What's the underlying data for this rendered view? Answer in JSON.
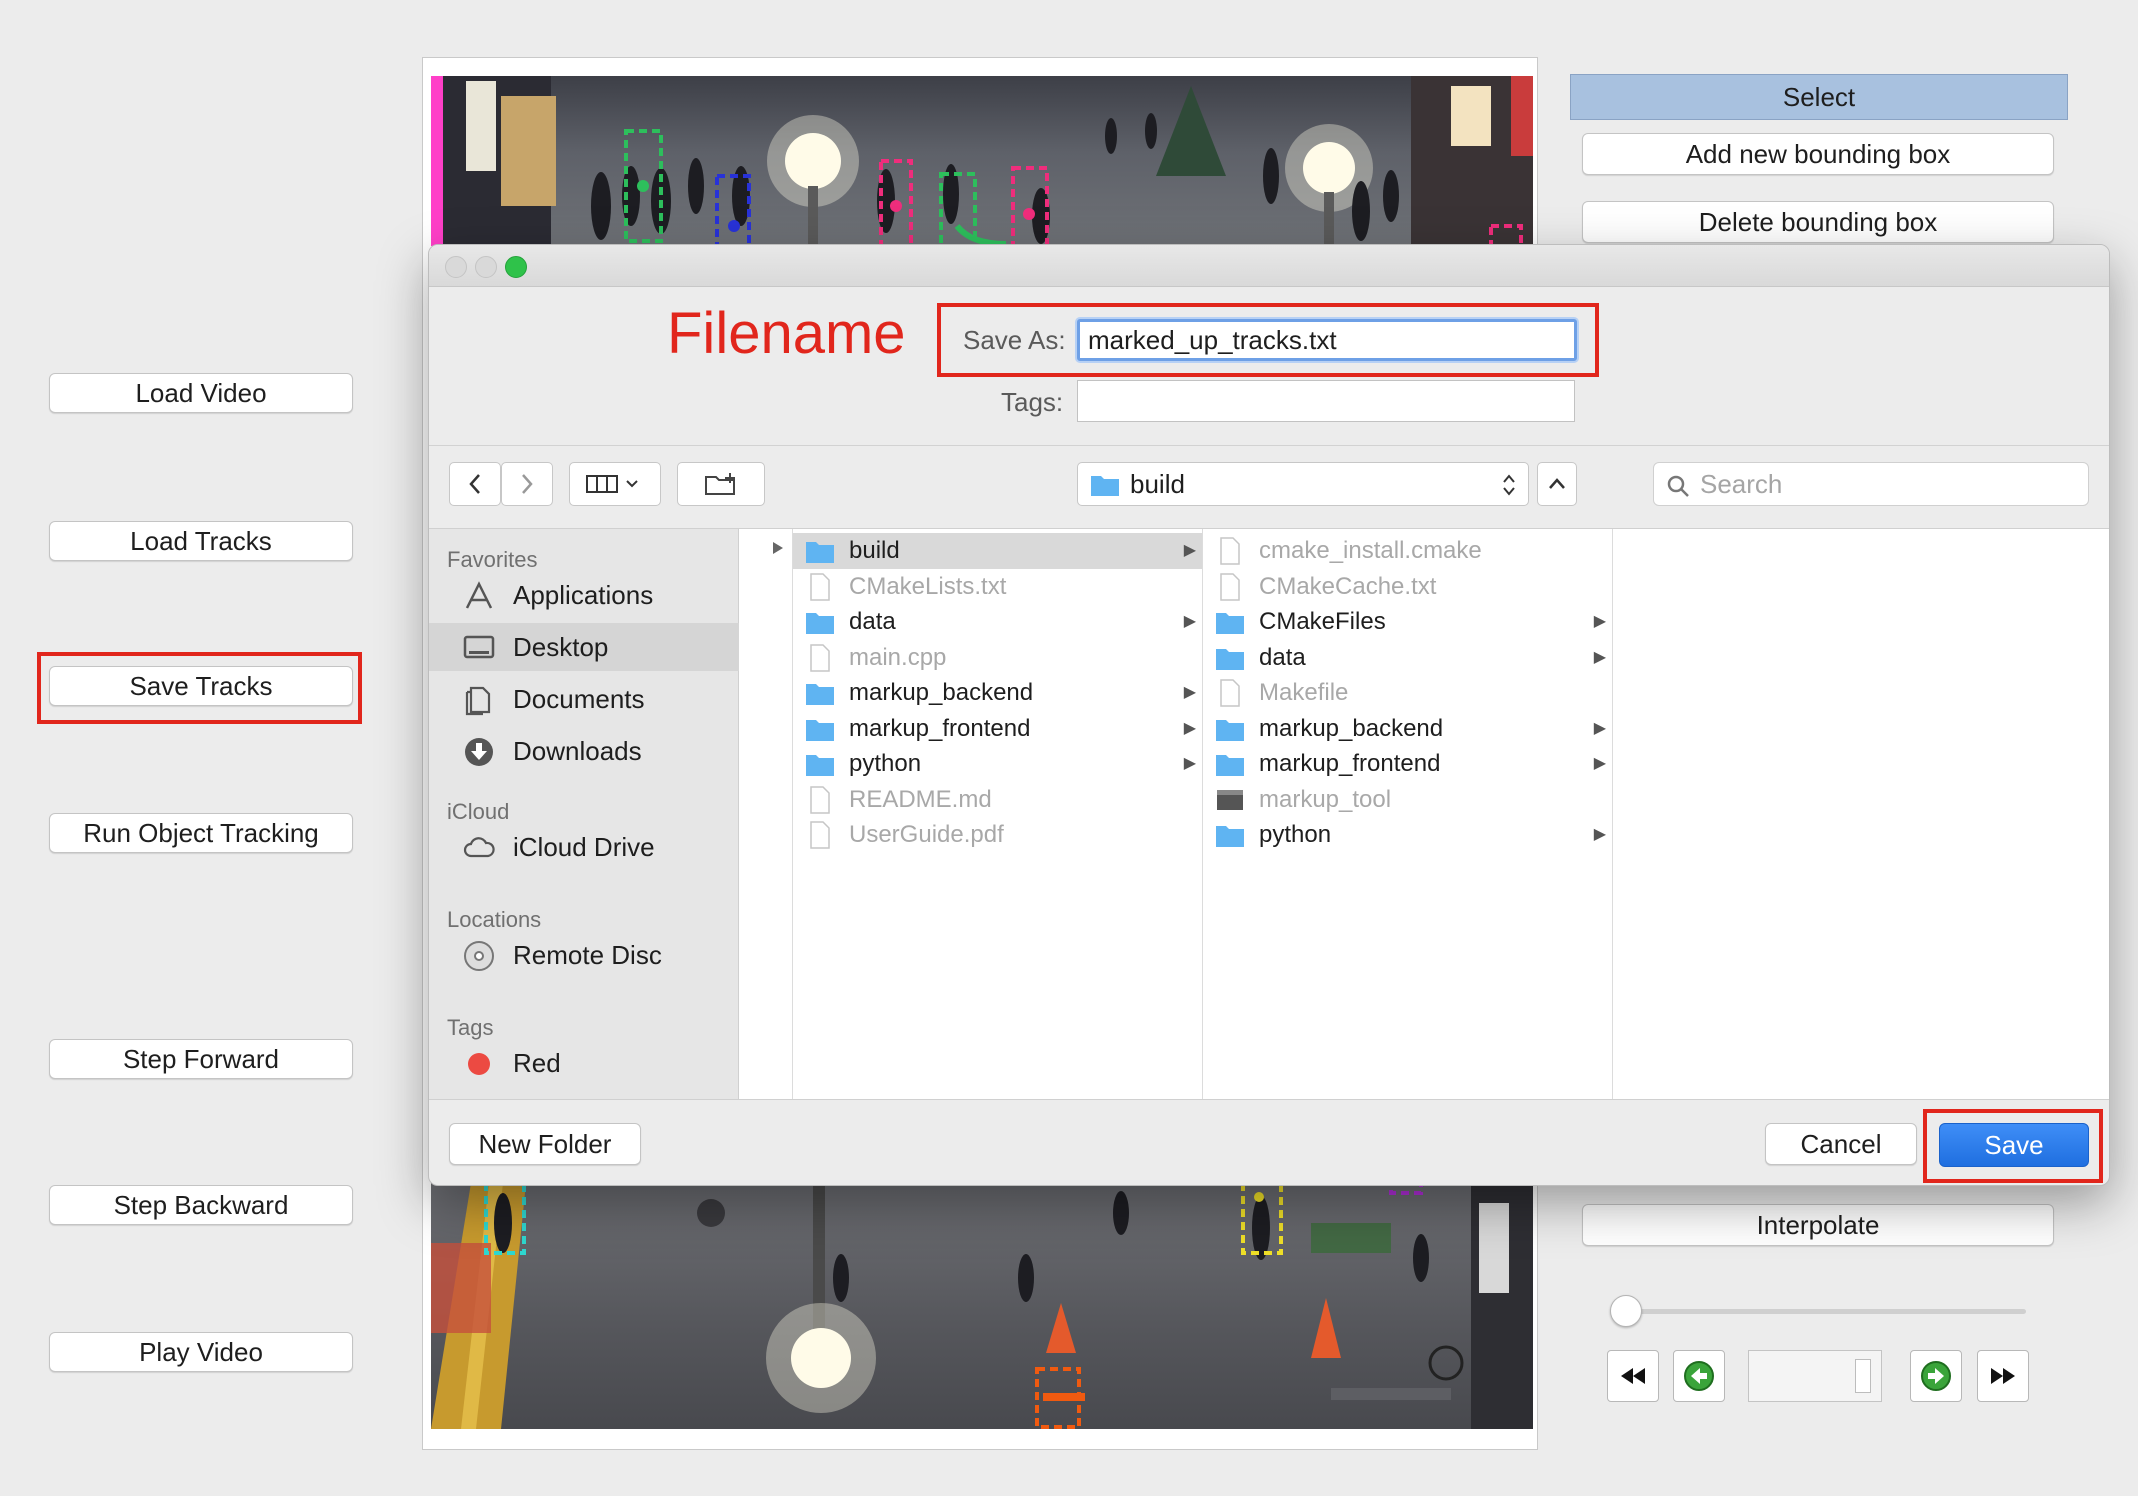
{
  "left_panel": {
    "buttons": [
      {
        "label": "Load Video"
      },
      {
        "label": "Load Tracks"
      },
      {
        "label": "Save Tracks"
      },
      {
        "label": "Run Object Tracking"
      },
      {
        "label": "Step Forward"
      },
      {
        "label": "Step Backward"
      },
      {
        "label": "Play Video"
      }
    ]
  },
  "right_panel": {
    "select_label": "Select",
    "add_box_label": "Add new bounding box",
    "delete_box_label": "Delete bounding box",
    "interpolate_label": "Interpolate",
    "frame_slider_fraction": 0.0
  },
  "dialog": {
    "annotation_label": "Filename",
    "save_as_label": "Save As:",
    "save_as_value": "marked_up_tracks.txt",
    "tags_label": "Tags:",
    "path_label": "build",
    "search_placeholder": "Search",
    "sidebar": {
      "favorites_heading": "Favorites",
      "favorites": [
        "Applications",
        "Desktop",
        "Documents",
        "Downloads"
      ],
      "icloud_heading": "iCloud",
      "icloud": [
        "iCloud Drive"
      ],
      "locations_heading": "Locations",
      "locations": [
        "Remote Disc"
      ],
      "tags_heading": "Tags",
      "tags": [
        "Red"
      ]
    },
    "column_2": [
      {
        "name": "build",
        "type": "folder",
        "selected": true
      },
      {
        "name": "CMakeLists.txt",
        "type": "file",
        "dim": true
      },
      {
        "name": "data",
        "type": "folder"
      },
      {
        "name": "main.cpp",
        "type": "file",
        "dim": true
      },
      {
        "name": "markup_backend",
        "type": "folder"
      },
      {
        "name": "markup_frontend",
        "type": "folder"
      },
      {
        "name": "python",
        "type": "folder"
      },
      {
        "name": "README.md",
        "type": "file",
        "dim": true
      },
      {
        "name": "UserGuide.pdf",
        "type": "file",
        "dim": true
      }
    ],
    "column_3": [
      {
        "name": "cmake_install.cmake",
        "type": "file",
        "dim": true
      },
      {
        "name": "CMakeCache.txt",
        "type": "file",
        "dim": true
      },
      {
        "name": "CMakeFiles",
        "type": "folder"
      },
      {
        "name": "data",
        "type": "folder"
      },
      {
        "name": "Makefile",
        "type": "file",
        "dim": true
      },
      {
        "name": "markup_backend",
        "type": "folder"
      },
      {
        "name": "markup_frontend",
        "type": "folder"
      },
      {
        "name": "markup_tool",
        "type": "exec",
        "dim": true
      },
      {
        "name": "python",
        "type": "folder"
      }
    ],
    "new_folder_label": "New Folder",
    "cancel_label": "Cancel",
    "save_label": "Save"
  },
  "colors": {
    "annotation_red": "#e1261c",
    "accent_blue": "#1f6fe0",
    "folder_blue": "#5fb4f2",
    "select_blue": "#a8c1df"
  }
}
